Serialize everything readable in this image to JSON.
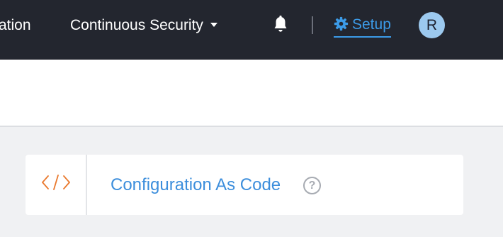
{
  "topnav": {
    "partial_item_label": "ation",
    "continuous_security_label": "Continuous Security",
    "bell_icon": "bell-icon",
    "setup_label": "Setup",
    "setup_icon": "gear-icon",
    "avatar_initial": "R",
    "accent_color": "#3c9be8",
    "background_color": "#23262f"
  },
  "card": {
    "icon": "code-icon",
    "title": "Configuration As Code",
    "help_glyph": "?"
  }
}
